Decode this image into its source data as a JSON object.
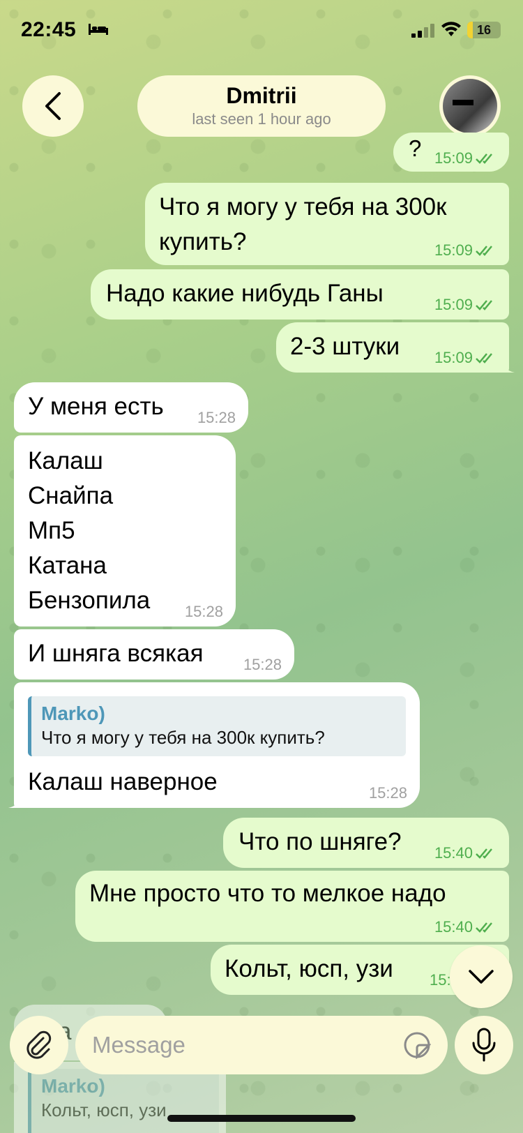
{
  "status_bar": {
    "time": "22:45",
    "battery": "16",
    "battery_level": 0.16
  },
  "header": {
    "name": "Dmitrii",
    "status": "last seen 1 hour ago"
  },
  "messages": [
    {
      "dir": "out",
      "text": "?",
      "time": "15:09"
    },
    {
      "dir": "out",
      "text": "Что я могу у тебя на 300к купить?",
      "time": "15:09"
    },
    {
      "dir": "out",
      "text": "Надо какие нибудь Ганы",
      "time": "15:09"
    },
    {
      "dir": "out",
      "text": "2-3 штуки",
      "time": "15:09"
    },
    {
      "dir": "in",
      "text": "У меня есть",
      "time": "15:28"
    },
    {
      "dir": "in",
      "lines": [
        "Калаш",
        "Снайпа",
        "Мп5",
        "Катана",
        "Бензопила"
      ],
      "time": "15:28"
    },
    {
      "dir": "in",
      "text": "И шняга всякая",
      "time": "15:28"
    },
    {
      "dir": "in",
      "reply_name": "Marko)",
      "reply_text": "Что я могу у тебя на 300к купить?",
      "text": "Калаш наверное",
      "time": "15:28"
    },
    {
      "dir": "out",
      "text": "Что по шняге?",
      "time": "15:40"
    },
    {
      "dir": "out",
      "text": "Мне просто что то мелкое надо",
      "time": "15:40"
    },
    {
      "dir": "out",
      "text": "Кольт, юсп, узи",
      "time": "15:4"
    },
    {
      "dir": "in",
      "reply_name": "Marko)",
      "reply_text": "Кольт, юсп, узи",
      "text": "Бла"
    }
  ],
  "composer": {
    "placeholder": "Message"
  },
  "colors": {
    "outgoing": "#e5fbcd",
    "incoming": "#ffffff",
    "accent": "#4fae4e",
    "reply_accent": "#4e97b8"
  },
  "icons": [
    "bed-icon",
    "signal-icon",
    "wifi-icon",
    "back-chevron-icon",
    "double-check-icon",
    "chevron-down-icon",
    "paperclip-icon",
    "sticker-icon",
    "microphone-icon"
  ]
}
